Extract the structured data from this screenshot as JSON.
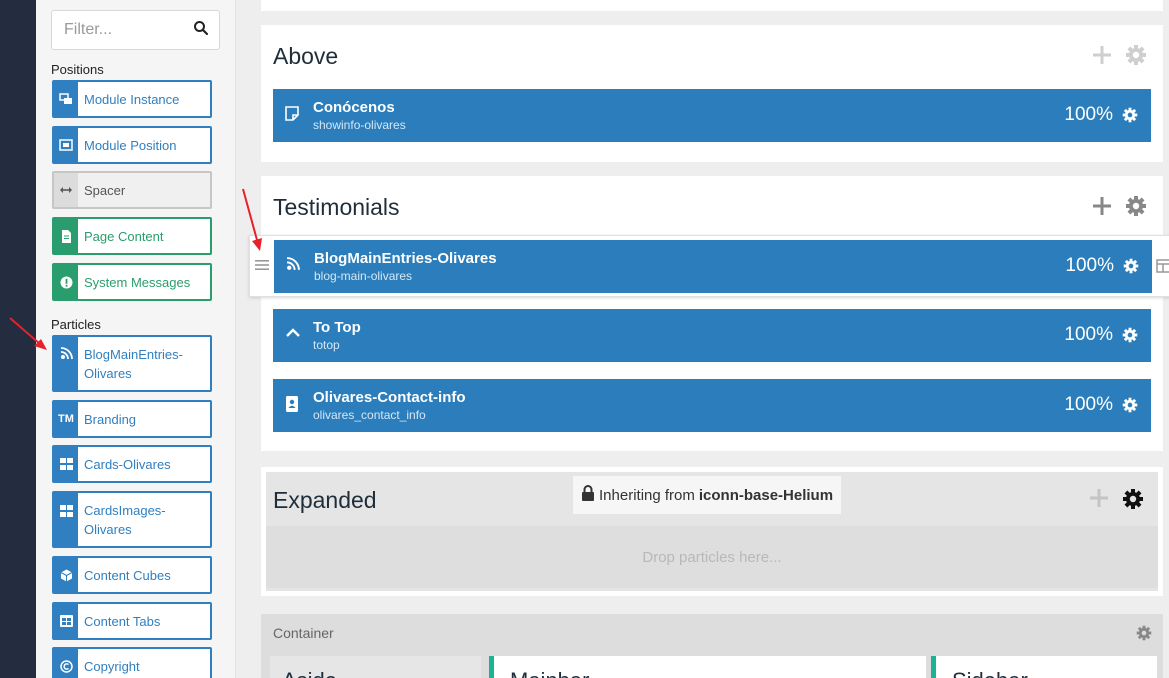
{
  "filter": {
    "placeholder": "Filter..."
  },
  "positions_label": "Positions",
  "positions": [
    {
      "label": "Module Instance",
      "icon": "module-instance-icon"
    },
    {
      "label": "Module Position",
      "icon": "module-position-icon"
    },
    {
      "label": "Spacer",
      "icon": "arrows-h-icon"
    },
    {
      "label": "Page Content",
      "icon": "file-icon"
    },
    {
      "label": "System Messages",
      "icon": "exclamation-icon"
    }
  ],
  "particles_label": "Particles",
  "particles": [
    {
      "label": "BlogMainEntries-Olivares",
      "icon": "rss-icon"
    },
    {
      "label": "Branding",
      "icon": "trademark-icon"
    },
    {
      "label": "Cards-Olivares",
      "icon": "grid-icon"
    },
    {
      "label": "CardsImages-Olivares",
      "icon": "grid-icon"
    },
    {
      "label": "Content Cubes",
      "icon": "cube-icon"
    },
    {
      "label": "Content Tabs",
      "icon": "table-icon"
    },
    {
      "label": "Copyright",
      "icon": "copyright-icon"
    }
  ],
  "sections": {
    "above": {
      "title": "Above",
      "modules": [
        {
          "title": "Conócenos",
          "sub": "showinfo-olivares",
          "pct": "100%",
          "icon": "note-icon"
        }
      ]
    },
    "testimonials": {
      "title": "Testimonials",
      "dragging": {
        "title": "BlogMainEntries-Olivares",
        "sub": "blog-main-olivares",
        "pct": "100%",
        "icon": "rss-icon"
      },
      "modules": [
        {
          "title": "To Top",
          "sub": "totop",
          "pct": "100%",
          "icon": "chevron-up-icon"
        },
        {
          "title": "Olivares-Contact-info",
          "sub": "olivares_contact_info",
          "pct": "100%",
          "icon": "contact-card-icon"
        }
      ]
    },
    "expanded": {
      "title": "Expanded",
      "inherit_prefix": "Inheriting from",
      "inherit_name": "iconn-base-Helium",
      "drop_text": "Drop particles here..."
    },
    "container": {
      "label": "Container",
      "columns": [
        "Aside",
        "Mainbar",
        "Sidebar"
      ]
    }
  },
  "colors": {
    "module_blue": "#2b7ebb",
    "particle_blue": "#2f7fc1",
    "green": "#2a9d6e",
    "teal": "#1ab394",
    "nav_dark": "#232d3f",
    "arrow_red": "#e8202a"
  }
}
